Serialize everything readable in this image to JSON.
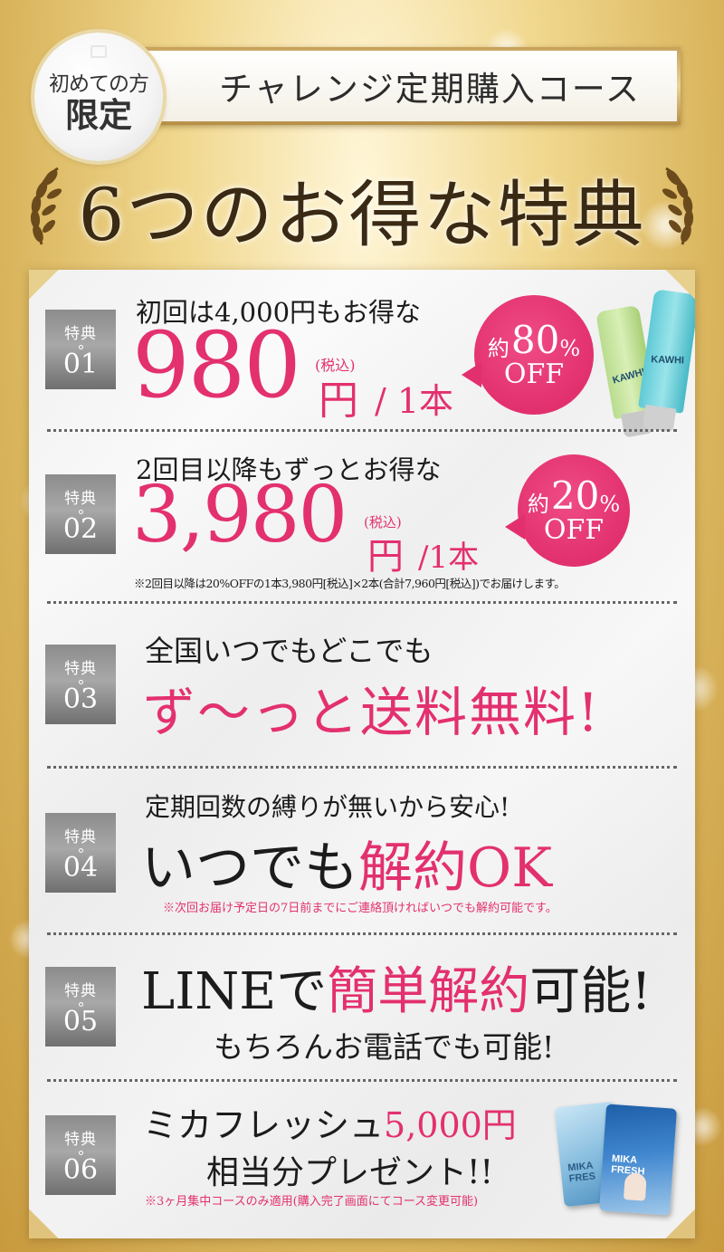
{
  "header": {
    "badge_line1": "初めての方",
    "badge_line2": "限定",
    "course_title": "チャレンジ定期購入コース",
    "main_heading": "6つのお得な特典"
  },
  "benefits": [
    {
      "tab_label": "特典",
      "tab_number": "01",
      "lead": "初回は4,000円もお得な",
      "price": "980",
      "tax": "(税込)",
      "yen": "円",
      "per": "/ 1本",
      "badge_prefix": "約",
      "badge_value": "80",
      "badge_pct": "%",
      "badge_off": "OFF",
      "product_label": "KAWHI"
    },
    {
      "tab_label": "特典",
      "tab_number": "02",
      "lead": "2回目以降もずっとお得な",
      "price": "3,980",
      "tax": "(税込)",
      "yen": "円",
      "per": "/1本",
      "badge_prefix": "約",
      "badge_value": "20",
      "badge_pct": "%",
      "badge_off": "OFF",
      "note": "※2回目以降は20%OFFの1本3,980円[税込]×2本(合計7,960円[税込])でお届けします。"
    },
    {
      "tab_label": "特典",
      "tab_number": "03",
      "lead": "全国いつでもどこでも",
      "highlight": "ず〜っと送料無料!"
    },
    {
      "tab_label": "特典",
      "tab_number": "04",
      "lead": "定期回数の縛りが無いから安心!",
      "main_black": "いつでも",
      "main_pink": "解約OK",
      "note": "※次回お届け予定日の7日前までにご連絡頂ければいつでも解約可能です。"
    },
    {
      "tab_label": "特典",
      "tab_number": "05",
      "main_black1": "LINEで",
      "main_pink": "簡単解約",
      "main_black2": "可能!",
      "sub": "もちろんお電話でも可能!"
    },
    {
      "tab_label": "特典",
      "tab_number": "06",
      "lead_black": "ミカフレッシュ",
      "lead_pink": "5,000円",
      "sub": "相当分プレゼント!!",
      "note": "※3ヶ月集中コースのみ適用(購入完了画面にてコース変更可能)",
      "book_label1": "MIKA FRES",
      "book_label2": "MIKA FRESH"
    }
  ],
  "colors": {
    "pink": "#e3306f",
    "gold": "#d9b45c",
    "tab_gray": "#8c8c8c"
  }
}
